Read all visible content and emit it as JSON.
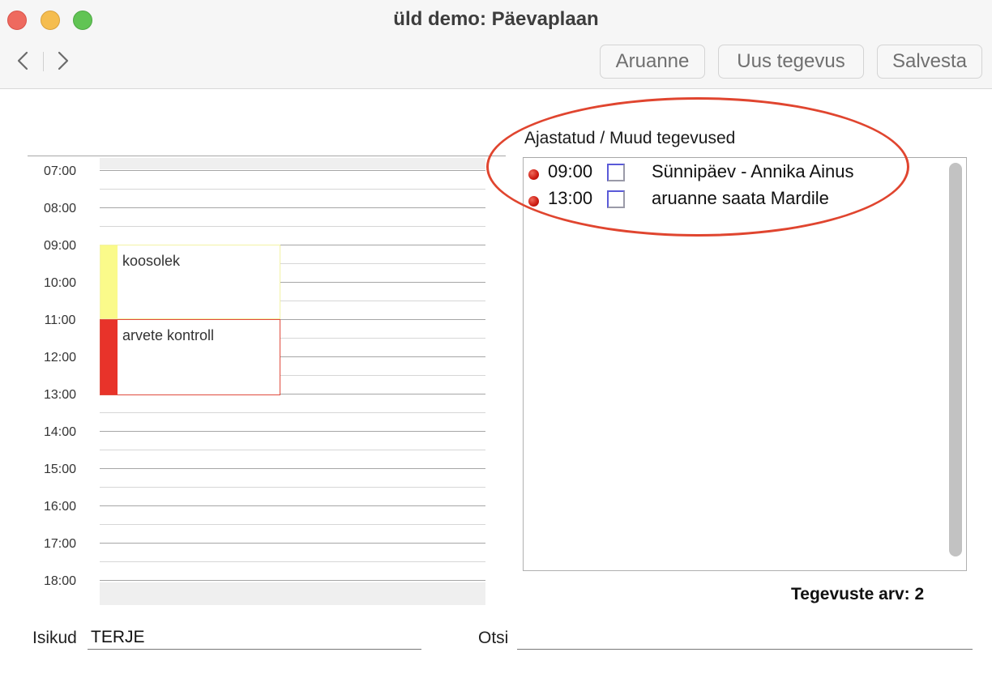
{
  "window": {
    "title": "üld demo: Päevaplaan"
  },
  "toolbar": {
    "back_icon": "chevron-left-icon",
    "forward_icon": "chevron-right-icon",
    "report_label": "Aruanne",
    "new_activity_label": "Uus tegevus",
    "save_label": "Salvesta"
  },
  "planner": {
    "hours": [
      "07:00",
      "08:00",
      "09:00",
      "10:00",
      "11:00",
      "12:00",
      "13:00",
      "14:00",
      "15:00",
      "16:00",
      "17:00",
      "18:00"
    ],
    "events": [
      {
        "title": "koosolek",
        "start": "09:00",
        "end": "11:00",
        "color": "#fafa8a"
      },
      {
        "title": "arvete kontroll",
        "start": "11:00",
        "end": "13:00",
        "color": "#e8332a"
      }
    ]
  },
  "activities": {
    "heading": "Ajastatud / Muud tegevused",
    "items": [
      {
        "time": "09:00",
        "title": "Sünnipäev - Annika Ainus",
        "checked": false
      },
      {
        "time": "13:00",
        "title": "aruanne saata Mardile",
        "checked": false
      }
    ],
    "count_label": "Tegevuste arv: 2",
    "highlight_color": "#e0452f"
  },
  "bottom": {
    "persons_label": "Isikud",
    "persons_value": "TERJE",
    "search_label": "Otsi",
    "search_value": ""
  }
}
